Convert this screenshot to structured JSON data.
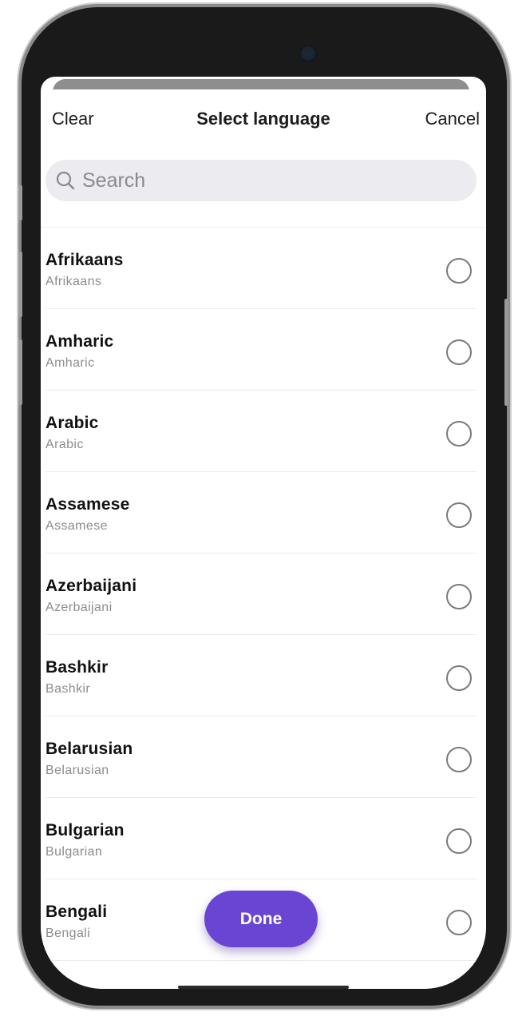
{
  "header": {
    "clear_label": "Clear",
    "title": "Select language",
    "cancel_label": "Cancel"
  },
  "search": {
    "placeholder": "Search",
    "value": ""
  },
  "languages": [
    {
      "name": "Afrikaans",
      "native": "Afrikaans",
      "selected": false
    },
    {
      "name": "Amharic",
      "native": "Amharic",
      "selected": false
    },
    {
      "name": "Arabic",
      "native": "Arabic",
      "selected": false
    },
    {
      "name": "Assamese",
      "native": "Assamese",
      "selected": false
    },
    {
      "name": "Azerbaijani",
      "native": "Azerbaijani",
      "selected": false
    },
    {
      "name": "Bashkir",
      "native": "Bashkir",
      "selected": false
    },
    {
      "name": "Belarusian",
      "native": "Belarusian",
      "selected": false
    },
    {
      "name": "Bulgarian",
      "native": "Bulgarian",
      "selected": false
    },
    {
      "name": "Bengali",
      "native": "Bengali",
      "selected": false
    }
  ],
  "done_label": "Done",
  "colors": {
    "accent": "#6a45d3",
    "search_bg": "#ececf0"
  }
}
